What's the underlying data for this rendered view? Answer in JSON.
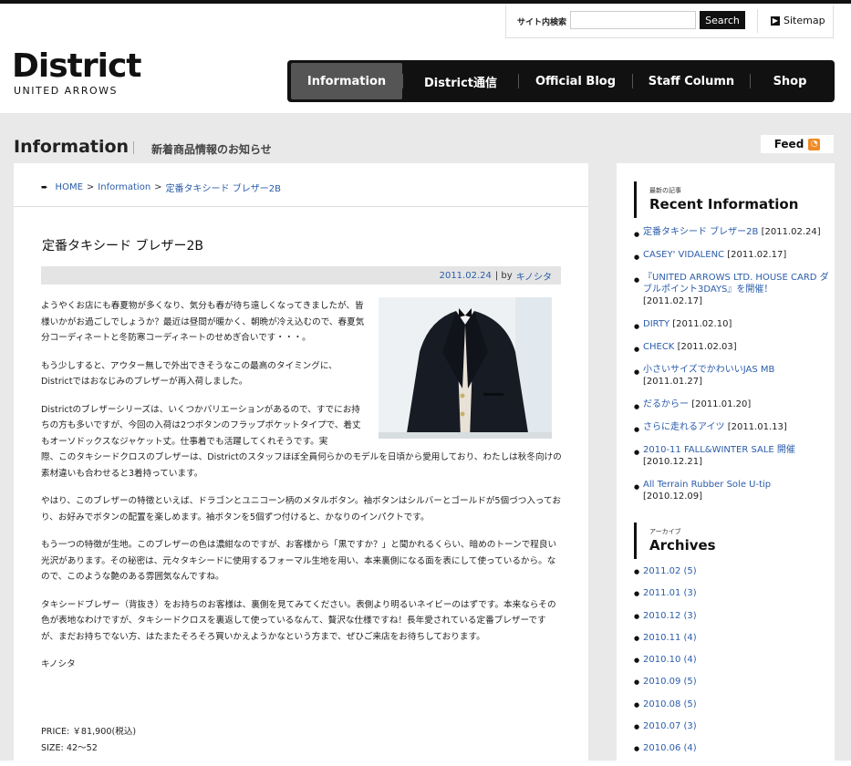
{
  "search": {
    "label": "サイト内検索",
    "placeholder": "",
    "button": "Search",
    "sitemap": "Sitemap"
  },
  "logo": {
    "main": "District",
    "sub": "UNITED ARROWS"
  },
  "nav": {
    "items": [
      {
        "label": "Information"
      },
      {
        "label": "District通信"
      },
      {
        "label": "Official Blog"
      },
      {
        "label": "Staff Column"
      },
      {
        "label": "Shop"
      }
    ]
  },
  "page": {
    "title": "Information",
    "subtitle": "新着商品情報のお知らせ",
    "feed": "Feed"
  },
  "breadcrumb": {
    "home": "HOME",
    "sep1": ">",
    "section": "Information",
    "sep2": ">",
    "current": "定番タキシード ブレザー2B"
  },
  "post": {
    "title": "定番タキシード ブレザー2B",
    "date": "2011.02.24",
    "by": "| by",
    "author": "キノシタ",
    "p1": "ようやくお店にも春夏物が多くなり、気分も春が待ち遠しくなってきましたが、皆様いかがお過ごしでしょうか？最近は昼間が暖かく、朝晩が冷え込むので、春夏気分コーディネートと冬防寒コーディネートのせめぎ合いです・・・。",
    "p2": "もう少しすると、アウター無しで外出できそうなこの最高のタイミングに、Districtではおなじみのブレザーが再入荷しました。",
    "p3a": "Districtのブレザーシリーズは、いくつかバリエーションがあるので、すでにお持ちの方も多いですが、今回の入荷は2つボタンのフラップポケットタイプで、着丈もオーソドックスなジャケット丈。仕事着でも活躍してくれそうです。実",
    "p3b": "際、このタキシードクロスのブレザーは、Districtのスタッフほぼ全員何らかのモデルを日頃から愛用しており、わたしは秋冬向けの素材違いも合わせると3着持っています。",
    "p4": "やはり、このブレザーの特徴といえば、ドラゴンとユニコーン柄のメタルボタン。袖ボタンはシルバーとゴールドが5個づつ入っており、お好みでボタンの配置を楽しめます。袖ボタンを5個ずつ付けると、かなりのインパクトです。",
    "p5": "もう一つの特徴が生地。このブレザーの色は濃紺なのですが、お客様から「黒ですか？」と聞かれるくらい、暗めのトーンで程良い光沢があります。その秘密は、元々タキシードに使用するフォーマル生地を用い、本来裏側になる面を表にして使っているから。なので、このような艶のある雰囲気なんですね。",
    "p6": "タキシードブレザー（背抜き）をお持ちのお客様は、裏側を見てみてください。表側より明るいネイビーのはずです。本来ならその色が表地なわけですが、タキシードクロスを裏返して使っているなんて、贅沢な仕様ですね！長年愛されている定番ブレザーですが、まだお持ちでない方、はたまたそろそろ買いかえようかなという方まで、ぜひご来店をお待ちしております。",
    "sign": "キノシタ",
    "price": "PRICE: ￥81,900(税込)",
    "size": "SIZE: 42～52"
  },
  "recent": {
    "small": "最新の記事",
    "title": "Recent Information",
    "items": [
      {
        "title": "定番タキシード ブレザー2B",
        "date": "[2011.02.24]"
      },
      {
        "title": "CASEY' VIDALENC",
        "date": "[2011.02.17]"
      },
      {
        "title": "『UNITED ARROWS LTD. HOUSE CARD ダブルポイント3DAYS』を開催！",
        "date": "[2011.02.17]"
      },
      {
        "title": "DIRTY",
        "date": "[2011.02.10]"
      },
      {
        "title": "CHECK",
        "date": "[2011.02.03]"
      },
      {
        "title": "小さいサイズでかわいいJAS MB",
        "date": "[2011.01.27]"
      },
      {
        "title": "だるからー",
        "date": "[2011.01.20]"
      },
      {
        "title": "さらに走れるアイツ",
        "date": "[2011.01.13]"
      },
      {
        "title": "2010-11 FALL&WINTER SALE 開催",
        "date": "[2010.12.21]"
      },
      {
        "title": "All Terrain Rubber Sole U-tip",
        "date": "[2010.12.09]"
      }
    ]
  },
  "archives": {
    "small": "アーカイブ",
    "title": "Archives",
    "items": [
      {
        "label": "2011.02 (5)"
      },
      {
        "label": "2011.01 (3)"
      },
      {
        "label": "2010.12 (3)"
      },
      {
        "label": "2010.11 (4)"
      },
      {
        "label": "2010.10 (4)"
      },
      {
        "label": "2010.09 (5)"
      },
      {
        "label": "2010.08 (5)"
      },
      {
        "label": "2010.07 (3)"
      },
      {
        "label": "2010.06 (4)"
      }
    ]
  }
}
